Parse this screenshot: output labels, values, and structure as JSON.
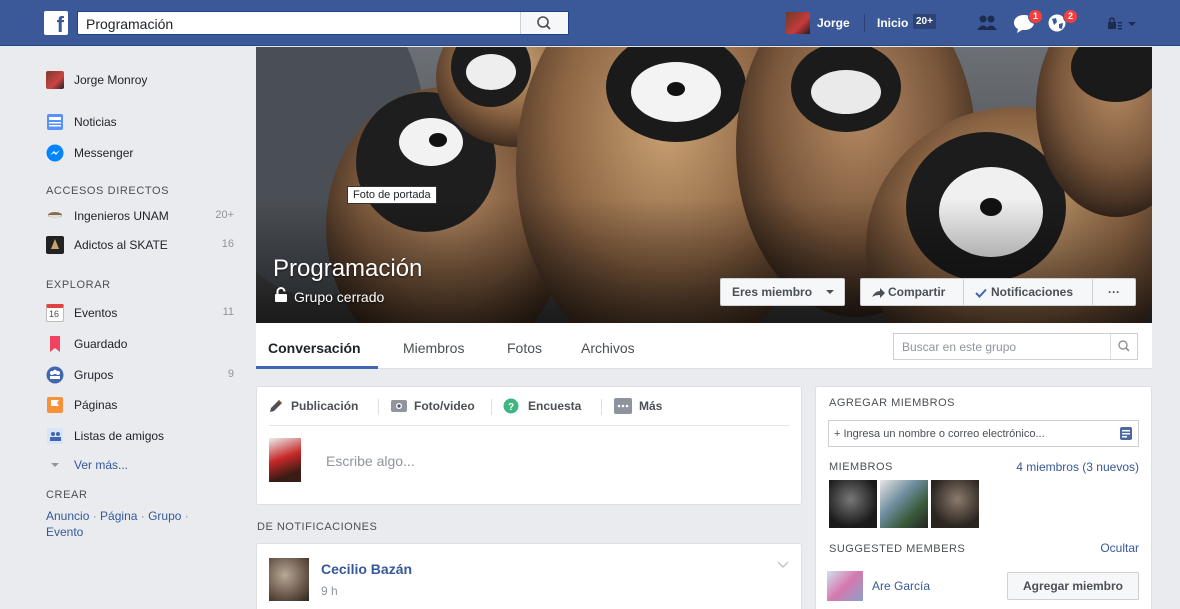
{
  "topbar": {
    "search_value": "Programación",
    "user_name": "Jorge",
    "home_label": "Inicio",
    "home_count": "20+",
    "friend_requests_badge": "",
    "messages_badge": "1",
    "notifications_badge": "2"
  },
  "sidebar": {
    "profile_name": "Jorge Monroy",
    "main": [
      {
        "label": "Noticias",
        "icon": "news-feed-icon"
      },
      {
        "label": "Messenger",
        "icon": "messenger-icon"
      }
    ],
    "shortcuts_title": "ACCESOS DIRECTOS",
    "shortcuts": [
      {
        "label": "Ingenieros UNAM",
        "count": "20+"
      },
      {
        "label": "Adictos al SKATE",
        "count": "16"
      }
    ],
    "explore_title": "EXPLORAR",
    "explore": [
      {
        "label": "Eventos",
        "count": "11",
        "calendar_day": "16"
      },
      {
        "label": "Guardado",
        "count": ""
      },
      {
        "label": "Grupos",
        "count": "9"
      },
      {
        "label": "Páginas",
        "count": ""
      },
      {
        "label": "Listas de amigos",
        "count": ""
      }
    ],
    "see_more": "Ver más...",
    "create_title": "CREAR",
    "create_links": [
      "Anuncio",
      "Página",
      "Grupo",
      "Evento"
    ],
    "create_separator": " · "
  },
  "cover": {
    "tooltip": "Foto de portada",
    "group_name": "Programación",
    "group_type": "Grupo cerrado",
    "member_button": "Eres miembro",
    "share_button": "Compartir",
    "notifications_button": "Notificaciones",
    "more_button": "···"
  },
  "tabs": [
    {
      "label": "Conversación",
      "active": true
    },
    {
      "label": "Miembros",
      "active": false
    },
    {
      "label": "Fotos",
      "active": false
    },
    {
      "label": "Archivos",
      "active": false
    }
  ],
  "group_search_placeholder": "Buscar en este grupo",
  "composer": {
    "tabs": [
      "Publicación",
      "Foto/video",
      "Encuesta",
      "Más"
    ],
    "placeholder": "Escribe algo..."
  },
  "feed": {
    "section_title": "DE NOTIFICACIONES",
    "post_author": "Cecilio Bazán",
    "post_time": "9 h"
  },
  "right_panel": {
    "add_members_title": "AGREGAR MIEMBROS",
    "add_members_placeholder": "+ Ingresa un nombre o correo electrónico...",
    "members_title": "MIEMBROS",
    "members_count": "4 miembros (3 nuevos)",
    "suggested_title": "SUGGESTED MEMBERS",
    "hide_link": "Ocultar",
    "suggested_name": "Are García",
    "add_member_button": "Agregar miembro"
  },
  "colors": {
    "brand": "#3b5998",
    "link": "#365899",
    "badge": "#fa3e3e"
  }
}
